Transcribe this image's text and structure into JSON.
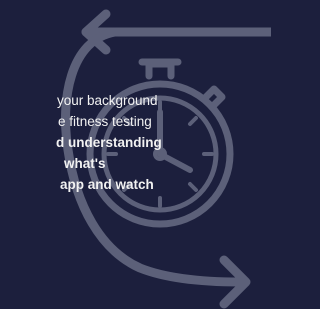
{
  "body_text": {
    "line_1": "your background",
    "line_2": "e fitness testing",
    "line_3": "d understanding",
    "line_4": "what's",
    "line_5": "app and watch"
  },
  "colors": {
    "background": "#1c1f3d",
    "art_stroke": "#5c6079",
    "text": "#f2f2f2"
  },
  "icons": [
    "cycle-arrows-icon",
    "stopwatch-icon"
  ]
}
